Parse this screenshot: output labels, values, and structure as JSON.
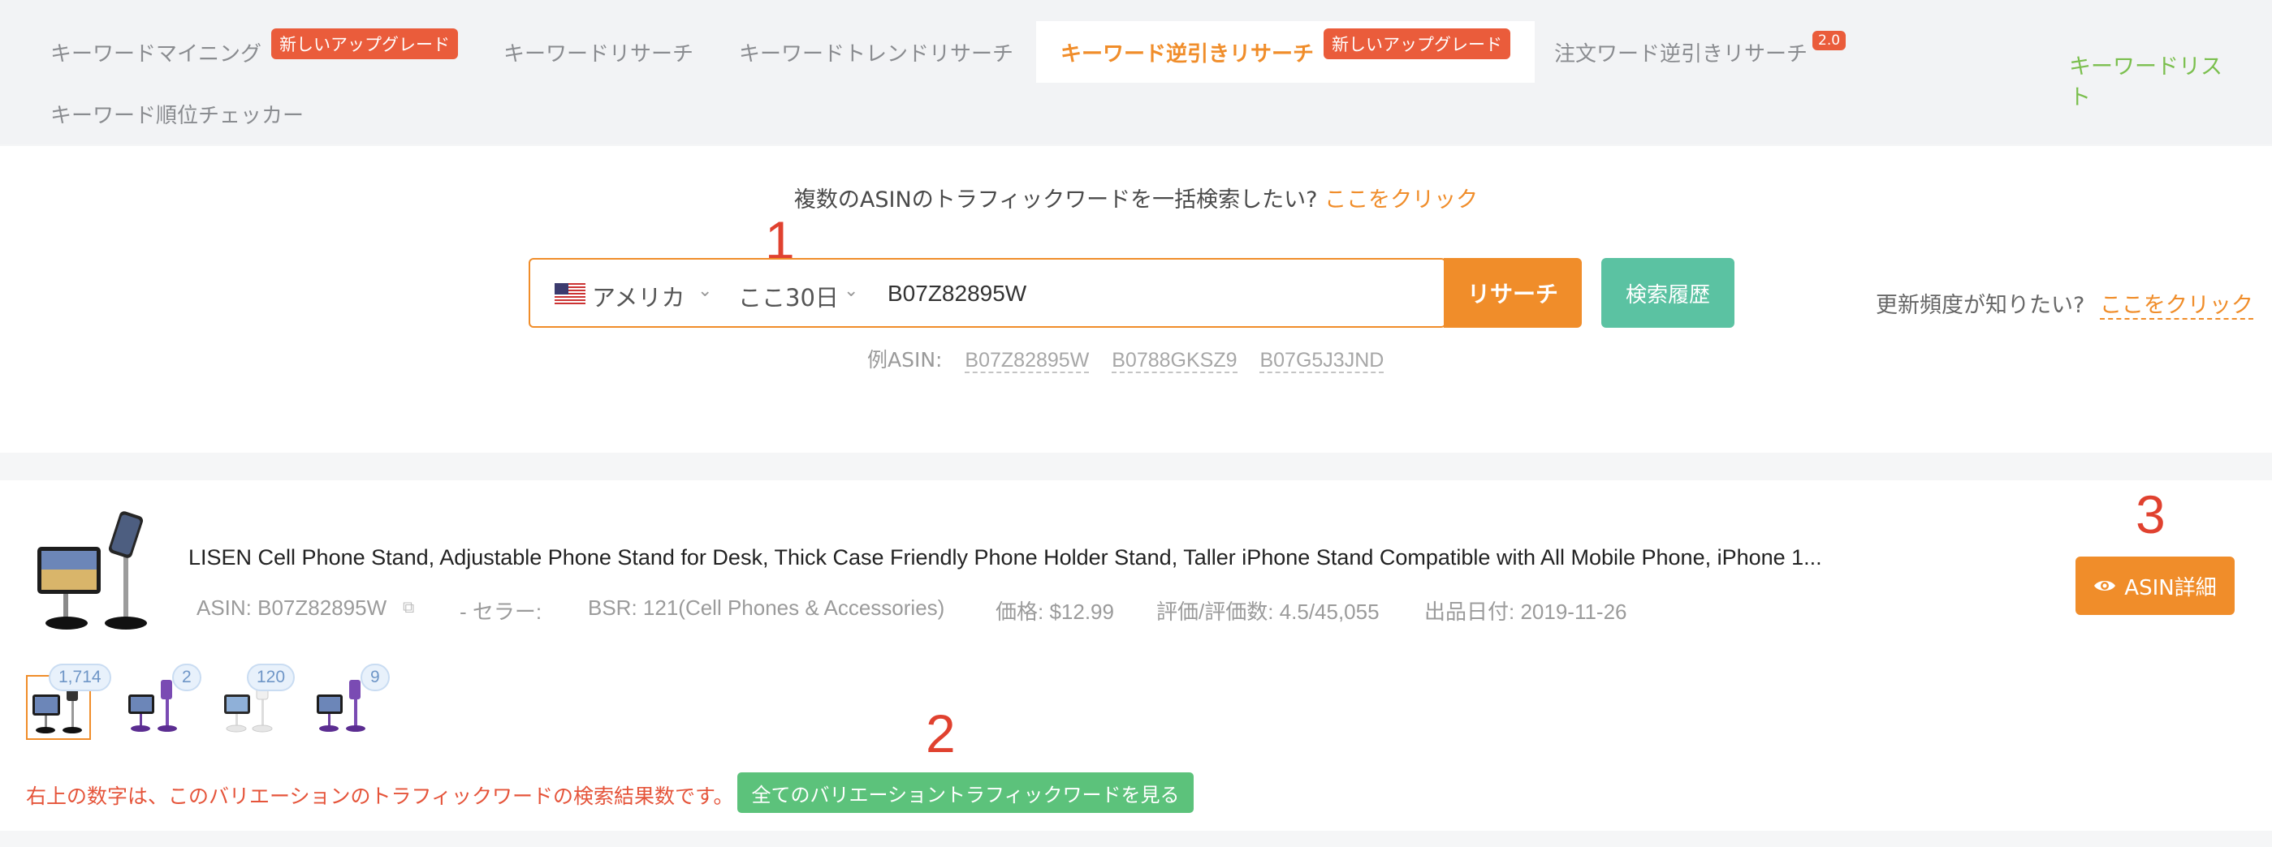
{
  "tabs": [
    {
      "label": "キーワードマイニング",
      "badge": "新しいアップグレード"
    },
    {
      "label": "キーワードリサーチ"
    },
    {
      "label": "キーワードトレンドリサーチ"
    },
    {
      "label": "キーワード逆引きリサーチ",
      "badge": "新しいアップグレード",
      "active": true
    },
    {
      "label": "注文ワード逆引きリサーチ",
      "version": "2.0"
    },
    {
      "label": "キーワード順位チェッカー"
    }
  ],
  "keyword_list_link": "キーワードリスト",
  "search": {
    "bulk_prompt": "複数のASINのトラフィックワードを一括検索したい?",
    "bulk_link": "ここをクリック",
    "country": "アメリカ",
    "period": "ここ30日",
    "asin_value": "B07Z82895W",
    "research_button": "リサーチ",
    "history_button": "検索履歴",
    "example_label": "例ASIN:",
    "examples": [
      "B07Z82895W",
      "B0788GKSZ9",
      "B07G5J3JND"
    ],
    "update_question": "更新頻度が知りたい?",
    "update_link": "ここをクリック"
  },
  "annotations": [
    "1",
    "2",
    "3"
  ],
  "product": {
    "title": "LISEN Cell Phone Stand, Adjustable Phone Stand for Desk, Thick Case Friendly Phone Holder Stand, Taller iPhone Stand Compatible with All Mobile Phone, iPhone 1...",
    "asin": "ASIN: B07Z82895W",
    "seller": "- セラー:",
    "bsr": "BSR: 121(Cell Phones & Accessories)",
    "price": "価格: $12.99",
    "rating": "評価/評価数: 4.5/45,055",
    "release_date": "出品日付: 2019-11-26",
    "detail_button": "ASIN詳細",
    "variations": [
      {
        "count": "1,714",
        "color": "black",
        "selected": true
      },
      {
        "count": "2",
        "color": "purple"
      },
      {
        "count": "120",
        "color": "white"
      },
      {
        "count": "9",
        "color": "purple"
      }
    ],
    "note": "右上の数字は、このバリエーションのトラフィックワードの検索結果数です。",
    "all_variations_button": "全てのバリエーショントラフィックワードを見る"
  },
  "colors": {
    "accent_orange": "#f08d2a",
    "green_button": "#5bc2a2",
    "badge_red": "#ea5c3b",
    "annotation_red": "#e0412f"
  }
}
